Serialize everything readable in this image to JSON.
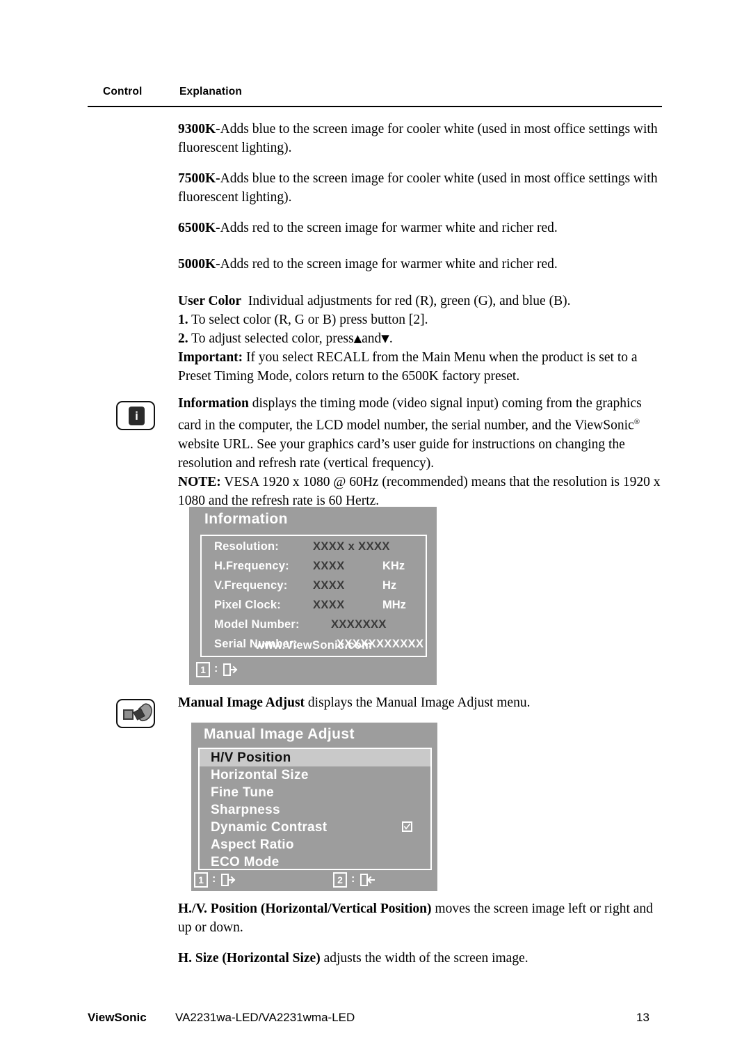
{
  "table_header": {
    "control": "Control",
    "explanation": "Explanation"
  },
  "paragraphs": {
    "p9300k_label": "9300K-",
    "p9300k_text": "Adds blue to the screen image for cooler white (used in most office settings with fluorescent lighting).",
    "p7500k_label": "7500K-",
    "p7500k_text": "Adds blue to the screen image for cooler white (used in most office settings with fluorescent lighting).",
    "p6500k_label": "6500K-",
    "p6500k_text": "Adds red to the screen image for warmer white and richer red.",
    "p5000k_label": "5000K-",
    "p5000k_text": "Adds red to the screen image for warmer white and richer red.",
    "user_color_label": "User Color",
    "user_color_text": "Individual adjustments for red (R), green (G),  and blue (B).",
    "user_color_step1_num": "1.",
    "user_color_step1_text": "To select color (R, G or B) press button [2].",
    "user_color_step2_num": "2.",
    "user_color_step2_text_a": "To adjust selected color, press",
    "user_color_step2_up": "▲",
    "user_color_step2_text_b": "and",
    "user_color_step2_down": "▼",
    "user_color_step2_text_c": ".",
    "important_label": "Important:",
    "important_text": "If you select RECALL from the Main Menu when the product is set to a Preset Timing Mode, colors return to the 6500K factory preset.",
    "information_label": "Information",
    "information_text_a": "displays the timing mode (video signal input) coming from the graphics card in the computer, the LCD model number, the serial number, and the ViewSonic",
    "information_reg": "®",
    "information_text_b": "website URL. See your graphics card’s user guide for instructions on changing the resolution and refresh rate (vertical frequency).",
    "note_label": "NOTE:",
    "note_text": "VESA 1920 x 1080 @ 60Hz (recommended) means that the resolution is 1920 x 1080 and the refresh rate is 60 Hertz.",
    "manual_image_adjust_label": "Manual Image Adjust",
    "manual_image_adjust_text": "displays the Manual Image Adjust menu.",
    "hv_position_label": "H./V. Position (Horizontal/Vertical Position)",
    "hv_position_text": "moves the screen image left or right and up or down.",
    "h_size_label": "H. Size (Horizontal Size)",
    "h_size_text": "adjusts the width of the screen image."
  },
  "information_osd": {
    "title": "Information",
    "rows": [
      {
        "label": "Resolution:",
        "value": "XXXX x XXXX",
        "unit": "",
        "value_white": false
      },
      {
        "label": "H.Frequency:",
        "value": "XXXX",
        "unit": "KHz",
        "value_white": false
      },
      {
        "label": "V.Frequency:",
        "value": "XXXX",
        "unit": "Hz",
        "value_white": false
      },
      {
        "label": "Pixel Clock:",
        "value": "XXXX",
        "unit": "MHz",
        "value_white": false
      },
      {
        "label": "Model Number:",
        "value": "XXXXXXX",
        "unit": "",
        "value_white": false
      },
      {
        "label": "Serial Number:",
        "value": "XXXXXXXXXXX",
        "unit": "",
        "value_white": true
      }
    ],
    "url": "www.ViewSonic.com",
    "hints": [
      {
        "key": "1",
        "colon": ":",
        "icon": "exit-right-icon"
      }
    ]
  },
  "manual_image_adjust_osd": {
    "title": "Manual Image Adjust",
    "items": [
      {
        "label": "H/V Position",
        "selected": true,
        "checkbox": false
      },
      {
        "label": "Horizontal Size",
        "selected": false,
        "checkbox": false
      },
      {
        "label": "Fine Tune",
        "selected": false,
        "checkbox": false
      },
      {
        "label": "Sharpness",
        "selected": false,
        "checkbox": false
      },
      {
        "label": "Dynamic Contrast",
        "selected": false,
        "checkbox": true
      },
      {
        "label": "Aspect Ratio",
        "selected": false,
        "checkbox": false
      },
      {
        "label": "ECO Mode",
        "selected": false,
        "checkbox": false
      }
    ],
    "hints": [
      {
        "key": "1",
        "colon": ":",
        "icon": "exit-right-icon"
      },
      {
        "key": "2",
        "colon": ":",
        "icon": "enter-left-icon"
      }
    ]
  },
  "icons": {
    "information": "info-icon",
    "manual_image_adjust": "manual-image-adjust-icon"
  },
  "footer": {
    "brand": "ViewSonic",
    "model": "VA2231wa-LED/VA2231wma-LED",
    "page": "13"
  },
  "colors": {
    "osd_background": "#9d9d9d",
    "osd_selected_row": "#c9c9c9",
    "osd_text": "#ffffff",
    "osd_value_text": "#3a3a3a",
    "page_background": "#ffffff",
    "text": "#000000"
  }
}
